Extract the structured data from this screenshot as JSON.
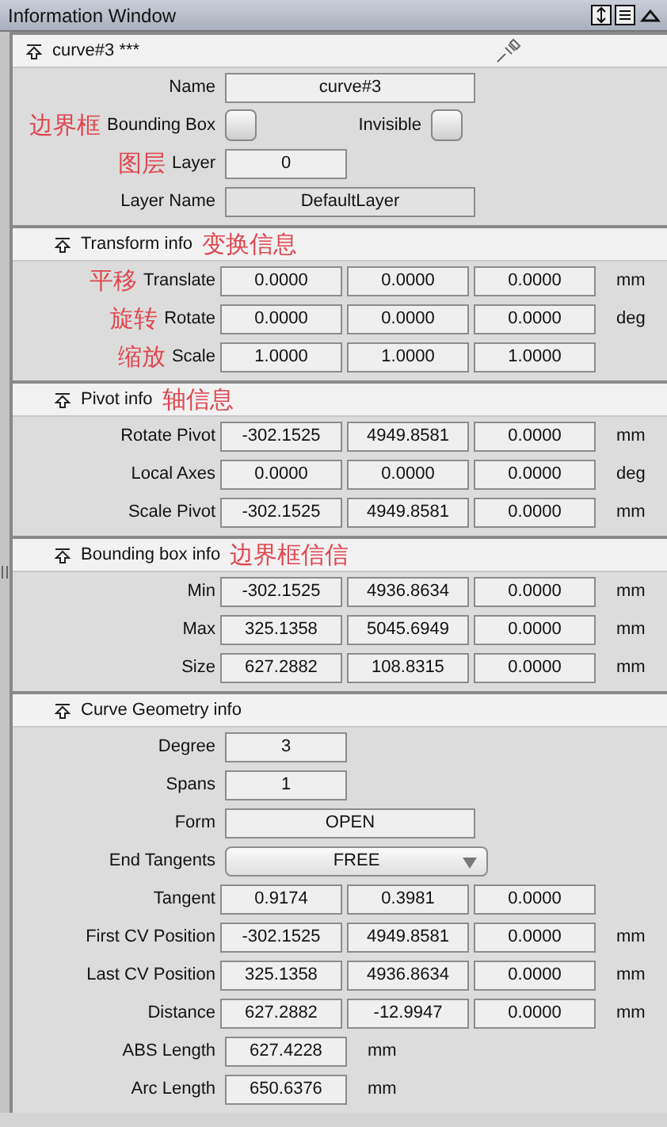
{
  "window": {
    "title": "Information Window"
  },
  "sections": [
    {
      "title": "curve#3 ***",
      "kind": "object",
      "rows": [
        {
          "kind": "text",
          "label": "Name",
          "value": "curve#3"
        },
        {
          "kind": "checks",
          "items": [
            {
              "label": "Bounding Box",
              "checked": false,
              "annotation": "边界框"
            },
            {
              "label": "Invisible",
              "checked": false
            }
          ]
        },
        {
          "kind": "number",
          "label": "Layer",
          "value": "0",
          "annotation": "图层"
        },
        {
          "kind": "text",
          "label": "Layer Name",
          "value": "DefaultLayer",
          "disabled": true
        }
      ]
    },
    {
      "title": "Transform info",
      "kind": "group",
      "annotation": "变换信息",
      "rows": [
        {
          "kind": "vector",
          "label": "Translate",
          "values": [
            "0.0000",
            "0.0000",
            "0.0000"
          ],
          "unit": "mm",
          "annotation": "平移"
        },
        {
          "kind": "vector",
          "label": "Rotate",
          "values": [
            "0.0000",
            "0.0000",
            "0.0000"
          ],
          "unit": "deg",
          "annotation": "旋转"
        },
        {
          "kind": "vector",
          "label": "Scale",
          "values": [
            "1.0000",
            "1.0000",
            "1.0000"
          ],
          "annotation": "缩放"
        }
      ]
    },
    {
      "title": "Pivot info",
      "kind": "group",
      "annotation": "轴信息",
      "rows": [
        {
          "kind": "vector",
          "label": "Rotate Pivot",
          "values": [
            "-302.1525",
            "4949.8581",
            "0.0000"
          ],
          "unit": "mm"
        },
        {
          "kind": "vector",
          "label": "Local Axes",
          "values": [
            "0.0000",
            "0.0000",
            "0.0000"
          ],
          "unit": "deg"
        },
        {
          "kind": "vector",
          "label": "Scale Pivot",
          "values": [
            "-302.1525",
            "4949.8581",
            "0.0000"
          ],
          "unit": "mm"
        }
      ]
    },
    {
      "title": "Bounding box info",
      "kind": "group",
      "annotation": "边界框信信",
      "rows": [
        {
          "kind": "vector",
          "label": "Min",
          "values": [
            "-302.1525",
            "4936.8634",
            "0.0000"
          ],
          "unit": "mm"
        },
        {
          "kind": "vector",
          "label": "Max",
          "values": [
            "325.1358",
            "5045.6949",
            "0.0000"
          ],
          "unit": "mm"
        },
        {
          "kind": "vector",
          "label": "Size",
          "values": [
            "627.2882",
            "108.8315",
            "0.0000"
          ],
          "unit": "mm"
        }
      ]
    },
    {
      "title": "Curve Geometry info",
      "kind": "group",
      "rows": [
        {
          "kind": "number",
          "label": "Degree",
          "value": "3"
        },
        {
          "kind": "number",
          "label": "Spans",
          "value": "1"
        },
        {
          "kind": "text",
          "label": "Form",
          "value": "OPEN"
        },
        {
          "kind": "select",
          "label": "End Tangents",
          "value": "FREE"
        },
        {
          "kind": "vector",
          "label": "Tangent",
          "values": [
            "0.9174",
            "0.3981",
            "0.0000"
          ]
        },
        {
          "kind": "vector",
          "label": "First CV Position",
          "values": [
            "-302.1525",
            "4949.8581",
            "0.0000"
          ],
          "unit": "mm"
        },
        {
          "kind": "vector",
          "label": "Last CV Position",
          "values": [
            "325.1358",
            "4936.8634",
            "0.0000"
          ],
          "unit": "mm"
        },
        {
          "kind": "vector",
          "label": "Distance",
          "values": [
            "627.2882",
            "-12.9947",
            "0.0000"
          ],
          "unit": "mm"
        },
        {
          "kind": "number",
          "label": "ABS Length",
          "value": "627.4228",
          "unit": "mm"
        },
        {
          "kind": "number",
          "label": "Arc Length",
          "value": "650.6376",
          "unit": "mm"
        }
      ]
    }
  ]
}
